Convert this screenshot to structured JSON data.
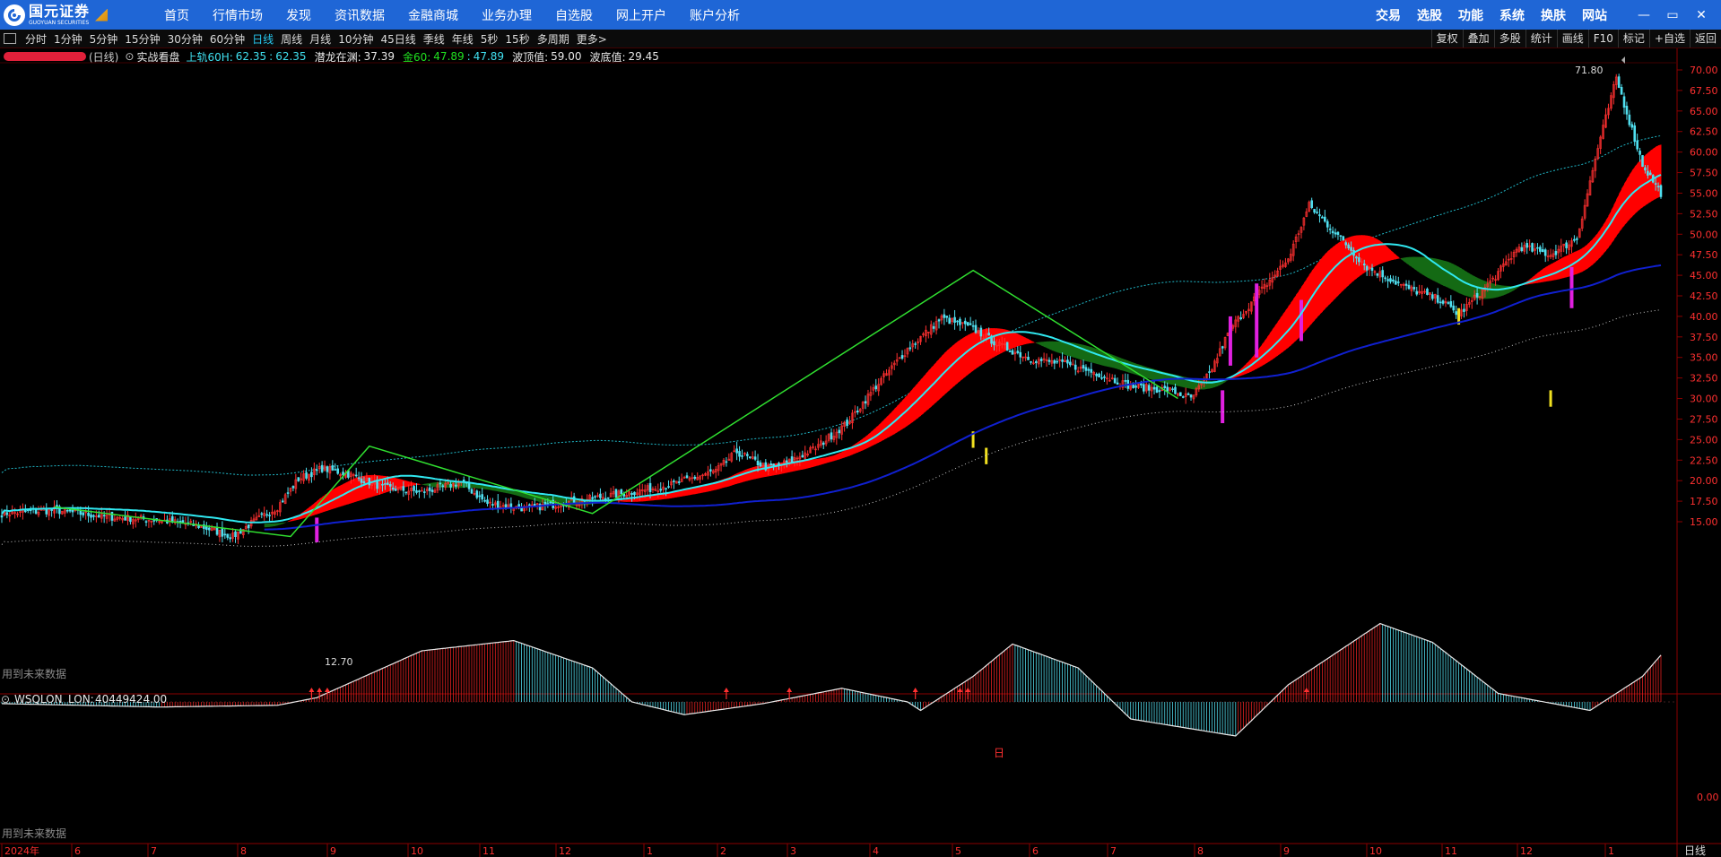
{
  "app": {
    "brand_cn": "国元证券",
    "brand_en": "GUOYUAN SECURITIES"
  },
  "nav": {
    "items": [
      "首页",
      "行情市场",
      "发现",
      "资讯数据",
      "金融商城",
      "业务办理",
      "自选股",
      "网上开户",
      "账户分析"
    ],
    "right": [
      "交易",
      "选股",
      "功能",
      "系统",
      "换肤",
      "网站"
    ],
    "window_controls": [
      "—",
      "▭",
      "✕"
    ]
  },
  "periods": {
    "items": [
      "分时",
      "1分钟",
      "5分钟",
      "15分钟",
      "30分钟",
      "60分钟",
      "日线",
      "周线",
      "月线",
      "10分钟",
      "45日线",
      "季线",
      "年线",
      "5秒",
      "15秒",
      "多周期",
      "更多>"
    ],
    "active": "日线"
  },
  "toolbar": {
    "items": [
      "复权",
      "叠加",
      "多股",
      "统计",
      "画线",
      "F10",
      "标记",
      "+自选",
      "返回"
    ]
  },
  "info": {
    "period_tag": "(日线)",
    "indicator_name": "实战看盘",
    "upper_label": "上轨60H:",
    "upper_value": "62.35",
    "upper_value2": "62.35",
    "dragon_label": "潜龙在渊:",
    "dragon_value": "37.39",
    "gold_label": "金60:",
    "gold_value": "47.89",
    "gold_value2": "47.89",
    "peak_label": "波顶值:",
    "peak_value": "59.00",
    "trough_label": "波底值:",
    "trough_value": "29.45"
  },
  "main_chart": {
    "max_label": "71.80",
    "min_label": "12.70",
    "future_data_note": "用到未来数据",
    "y_ticks": [
      "70.00",
      "67.50",
      "65.00",
      "62.50",
      "60.00",
      "57.50",
      "55.00",
      "52.50",
      "50.00",
      "47.50",
      "45.00",
      "42.50",
      "40.00",
      "37.50",
      "35.00",
      "32.50",
      "30.00",
      "27.50",
      "25.00",
      "22.50",
      "20.00",
      "17.50",
      "15.00"
    ]
  },
  "sub_chart": {
    "name": "WSQLON",
    "lon_label": "LON:",
    "lon_value": "40449424.00",
    "zero_tick": "0.00",
    "future_data_note": "用到未来数据",
    "zero_marker": "日",
    "n_markers": "n"
  },
  "x_axis": {
    "labels": [
      "2024年",
      "6",
      "7",
      "8",
      "9",
      "10",
      "11",
      "12",
      "1",
      "2",
      "3",
      "4",
      "5",
      "6",
      "7",
      "8",
      "9",
      "10",
      "11",
      "12",
      "1"
    ],
    "period_label": "日线"
  },
  "colors": {
    "up": "#ff3030",
    "down": "#50e0f0",
    "band": "#ff0000",
    "band_down": "#1a6e1a",
    "grid_axis": "#8a0000",
    "nav_bg": "#1f66d6"
  },
  "chart_data": {
    "type": "candlestick",
    "x_start": "2024年",
    "x_months": [
      "2024年",
      "6",
      "7",
      "8",
      "9",
      "10",
      "11",
      "12",
      "1",
      "2",
      "3",
      "4",
      "5",
      "6",
      "7",
      "8",
      "9",
      "10",
      "11",
      "12",
      "1"
    ],
    "ylim": [
      12.7,
      71.8
    ],
    "y_ticks": [
      15.0,
      17.5,
      20.0,
      22.5,
      25.0,
      27.5,
      30.0,
      32.5,
      35.0,
      37.5,
      40.0,
      42.5,
      45.0,
      47.5,
      50.0,
      52.5,
      55.0,
      57.5,
      60.0,
      62.5,
      65.0,
      67.5,
      70.0
    ],
    "close_path": [
      [
        0,
        16.0
      ],
      [
        20,
        16.4
      ],
      [
        40,
        15.6
      ],
      [
        60,
        15.2
      ],
      [
        75,
        14.5
      ],
      [
        88,
        13.2
      ],
      [
        95,
        14.8
      ],
      [
        105,
        16.8
      ],
      [
        113,
        20.2
      ],
      [
        122,
        21.5
      ],
      [
        132,
        20.8
      ],
      [
        145,
        19.2
      ],
      [
        160,
        18.6
      ],
      [
        175,
        19.8
      ],
      [
        185,
        17.2
      ],
      [
        200,
        16.6
      ],
      [
        220,
        17.6
      ],
      [
        240,
        18.6
      ],
      [
        255,
        19.5
      ],
      [
        272,
        21.2
      ],
      [
        280,
        23.5
      ],
      [
        292,
        21.5
      ],
      [
        300,
        22.3
      ],
      [
        310,
        24.0
      ],
      [
        322,
        27.0
      ],
      [
        333,
        31.5
      ],
      [
        345,
        36.0
      ],
      [
        358,
        39.8
      ],
      [
        370,
        38.5
      ],
      [
        380,
        36.5
      ],
      [
        392,
        34.8
      ],
      [
        405,
        34.2
      ],
      [
        418,
        33.0
      ],
      [
        430,
        31.5
      ],
      [
        445,
        31.0
      ],
      [
        453,
        30.0
      ],
      [
        460,
        33.0
      ],
      [
        468,
        38.5
      ],
      [
        478,
        42.5
      ],
      [
        490,
        47.0
      ],
      [
        498,
        53.5
      ],
      [
        510,
        49.5
      ],
      [
        520,
        46.0
      ],
      [
        535,
        43.5
      ],
      [
        548,
        42.0
      ],
      [
        555,
        40.2
      ],
      [
        568,
        44.5
      ],
      [
        578,
        48.5
      ],
      [
        590,
        47.5
      ],
      [
        600,
        49.5
      ],
      [
        608,
        60.5
      ],
      [
        615,
        69.0
      ],
      [
        625,
        58.5
      ],
      [
        632,
        55.0
      ]
    ]
  }
}
